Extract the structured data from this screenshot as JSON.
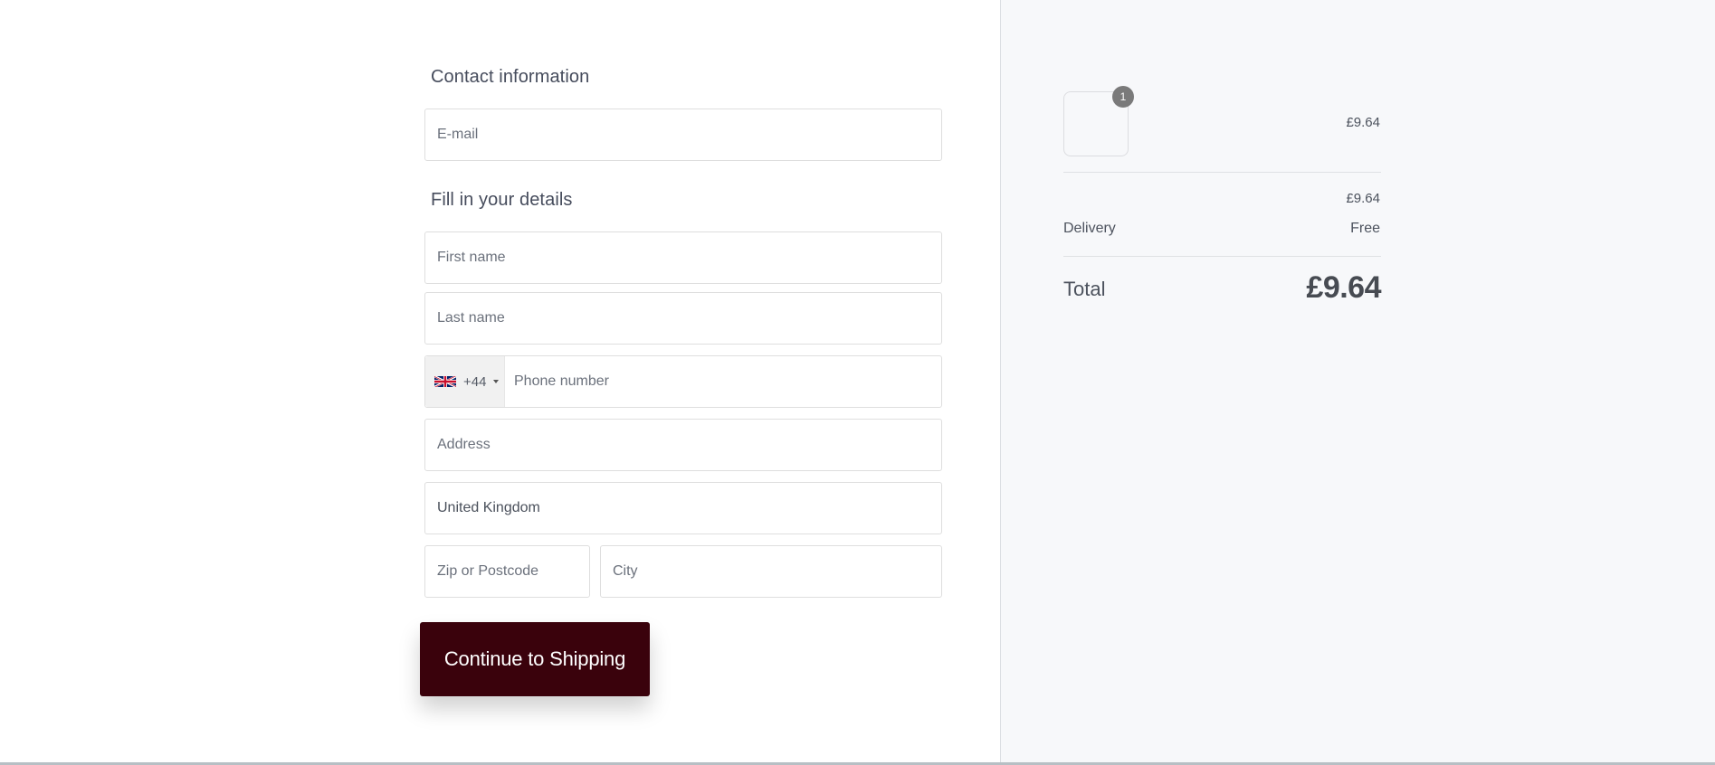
{
  "contact": {
    "title": "Contact information",
    "email_placeholder": "E-mail"
  },
  "details": {
    "title": "Fill in your details",
    "first_name_placeholder": "First name",
    "last_name_placeholder": "Last name",
    "phone": {
      "country_flag": "uk-flag-icon",
      "dial_code": "+44",
      "placeholder": "Phone number"
    },
    "address_placeholder": "Address",
    "country_value": "United Kingdom",
    "postcode_placeholder": "Zip or Postcode",
    "city_placeholder": "City"
  },
  "actions": {
    "continue_label": "Continue to Shipping"
  },
  "colors": {
    "primary_button": "#3a020c",
    "summary_background": "#f7f8fa"
  },
  "summary": {
    "item": {
      "quantity": "1",
      "price": "£9.64"
    },
    "subtotal": "£9.64",
    "delivery_label": "Delivery",
    "delivery_value": "Free",
    "total_label": "Total",
    "total_value": "£9.64"
  }
}
